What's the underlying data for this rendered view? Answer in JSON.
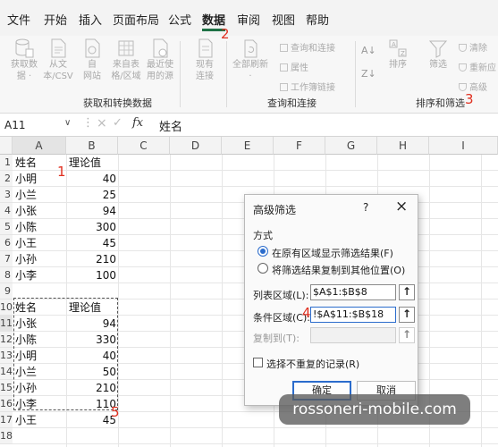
{
  "menu": {
    "tabs": [
      "文件",
      "开始",
      "插入",
      "页面布局",
      "公式",
      "数据",
      "审阅",
      "视图",
      "帮助"
    ],
    "active_tab": "数据"
  },
  "ribbon": {
    "get_transform": {
      "buttons": [
        "获取数\n据 ·",
        "从文\n本/CSV",
        "自\n网站",
        "来自表\n格/区域",
        "最近使\n用的源"
      ],
      "existing": "现有\n连接",
      "label": "获取和转换数据"
    },
    "queries": {
      "refresh": "全部刷新\n·",
      "items": [
        "查询和连接",
        "属性",
        "工作簿链接"
      ],
      "label": "查询和连接"
    },
    "sort_filter": {
      "sort": "排序",
      "filter": "筛选",
      "items": [
        "清除",
        "重新应",
        "高级"
      ],
      "label": "排序和筛选"
    }
  },
  "formula_bar": {
    "name_box": "A11",
    "fx": "fx",
    "value": "姓名"
  },
  "sheet": {
    "columns": [
      "A",
      "B",
      "C",
      "D",
      "E",
      "F",
      "G",
      "H",
      "I"
    ],
    "rows": [
      "1",
      "2",
      "3",
      "4",
      "5",
      "6",
      "7",
      "8",
      "9",
      "10",
      "11",
      "12",
      "13",
      "14",
      "15",
      "16",
      "17",
      "18"
    ],
    "table1": {
      "header": [
        "姓名",
        "理论值"
      ],
      "rows": [
        [
          "小明",
          "40"
        ],
        [
          "小兰",
          "25"
        ],
        [
          "小张",
          "94"
        ],
        [
          "小陈",
          "300"
        ],
        [
          "小王",
          "45"
        ],
        [
          "小孙",
          "210"
        ],
        [
          "小李",
          "100"
        ]
      ]
    },
    "table2": {
      "header": [
        "姓名",
        "理论值"
      ],
      "rows": [
        [
          "小张",
          "94"
        ],
        [
          "小陈",
          "330"
        ],
        [
          "小明",
          "40"
        ],
        [
          "小兰",
          "50"
        ],
        [
          "小孙",
          "210"
        ],
        [
          "小李",
          "110"
        ],
        [
          "小王",
          "45"
        ]
      ]
    }
  },
  "dialog": {
    "title": "高级筛选",
    "help": "?",
    "close": "×",
    "section": "方式",
    "option1": "在原有区域显示筛选结果(F)",
    "option2": "将筛选结果复制到其他位置(O)",
    "list_range_label": "列表区域(L):",
    "list_range_value": "$A$1:$B$8",
    "criteria_range_label": "条件区域(C):",
    "criteria_range_value": "!$A$11:$B$18",
    "copy_to_label": "复制到(T):",
    "copy_to_value": "",
    "ref_icon": "↑",
    "unique_label": "选择不重复的记录(R)",
    "ok": "确定",
    "cancel": "取消"
  },
  "annotations": [
    "1",
    "2",
    "3",
    "4",
    "5"
  ],
  "watermark": "rossoneri-mobile.com",
  "colors": {
    "accent": "#1e7145",
    "annotation": "#e03020",
    "radio": "#2b6ccc"
  }
}
